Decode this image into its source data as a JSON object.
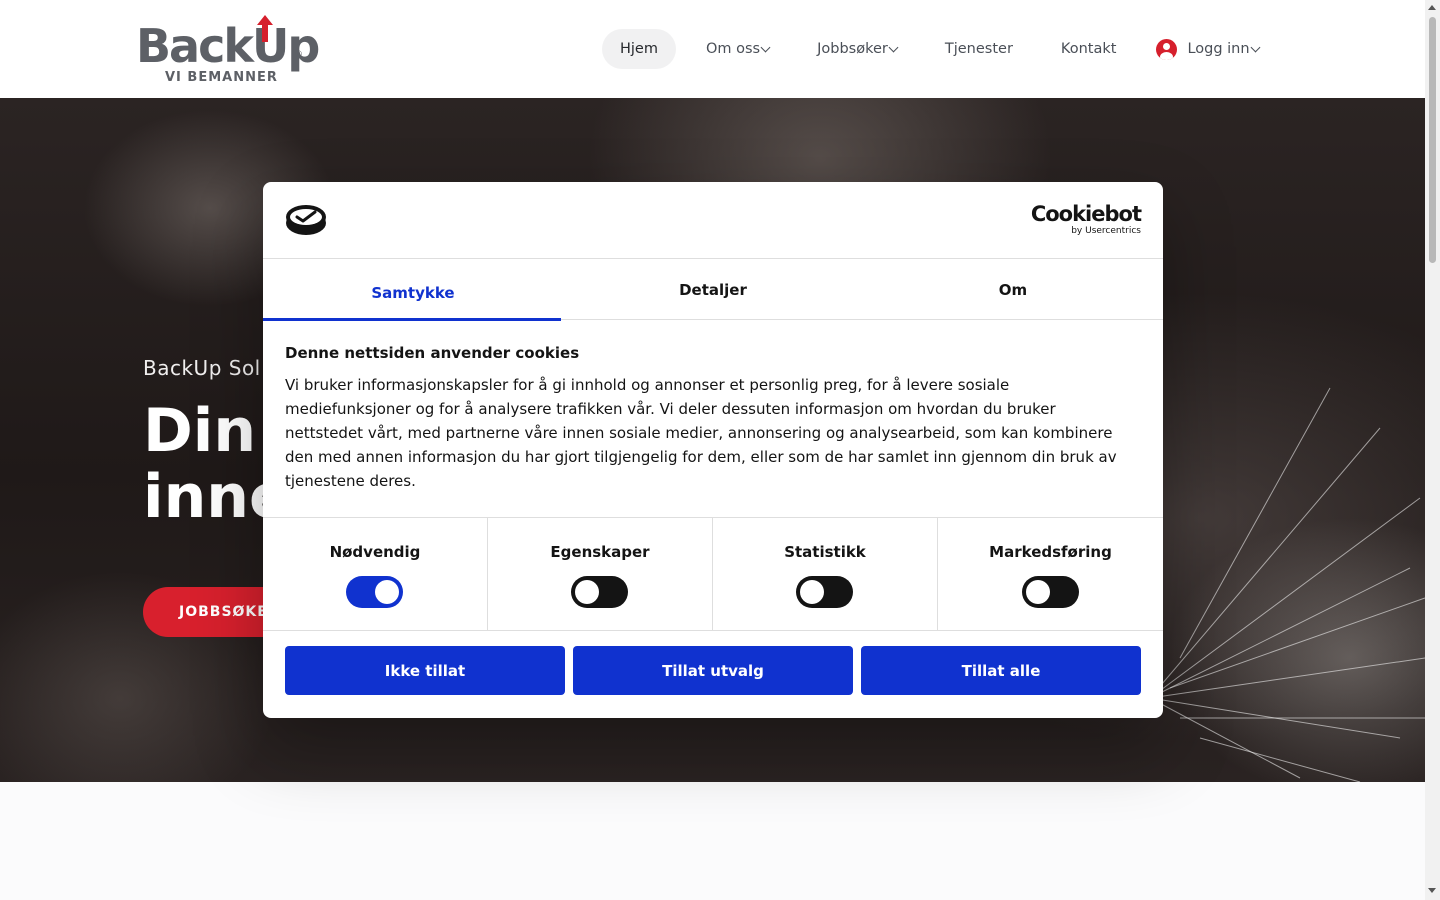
{
  "brand": {
    "logo_text_back": "Back",
    "logo_text_up": "Up",
    "logo_reg": "®",
    "tagline": "VI BEMANNER",
    "accent_color": "#d61f2c"
  },
  "nav": {
    "items": [
      {
        "label": "Hjem",
        "active": true
      },
      {
        "label": "Om oss",
        "dropdown": true
      },
      {
        "label": "Jobbsøker",
        "dropdown": true
      },
      {
        "label": "Tjenester"
      },
      {
        "label": "Kontakt"
      }
    ],
    "login": {
      "label": "Logg inn",
      "icon": "user-circle-icon"
    }
  },
  "hero": {
    "kicker": "BackUp Sol",
    "headline": "Din\ninne",
    "cta_label": "JOBBSØKE"
  },
  "cookie_dialog": {
    "brand_name": "Cookiebot",
    "brand_by": "by Usercentrics",
    "tabs": [
      {
        "label": "Samtykke",
        "active": true
      },
      {
        "label": "Detaljer"
      },
      {
        "label": "Om"
      }
    ],
    "title": "Denne nettsiden anvender cookies",
    "body": "Vi bruker informasjonskapsler for å gi innhold og annonser et personlig preg, for å levere sosiale mediefunksjoner og for å analysere trafikken vår. Vi deler dessuten informasjon om hvordan du bruker nettstedet vårt, med partnerne våre innen sosiale medier, annonsering og analysearbeid, som kan kombinere den med annen informasjon du har gjort tilgjengelig for dem, eller som de har samlet inn gjennom din bruk av tjenestene deres.",
    "categories": [
      {
        "label": "Nødvendig",
        "enabled": true
      },
      {
        "label": "Egenskaper",
        "enabled": false
      },
      {
        "label": "Statistikk",
        "enabled": false
      },
      {
        "label": "Markedsføring",
        "enabled": false
      }
    ],
    "buttons": {
      "deny": "Ikke tillat",
      "allow_selection": "Tillat utvalg",
      "allow_all": "Tillat alle"
    },
    "primary_color": "#1032cf"
  }
}
